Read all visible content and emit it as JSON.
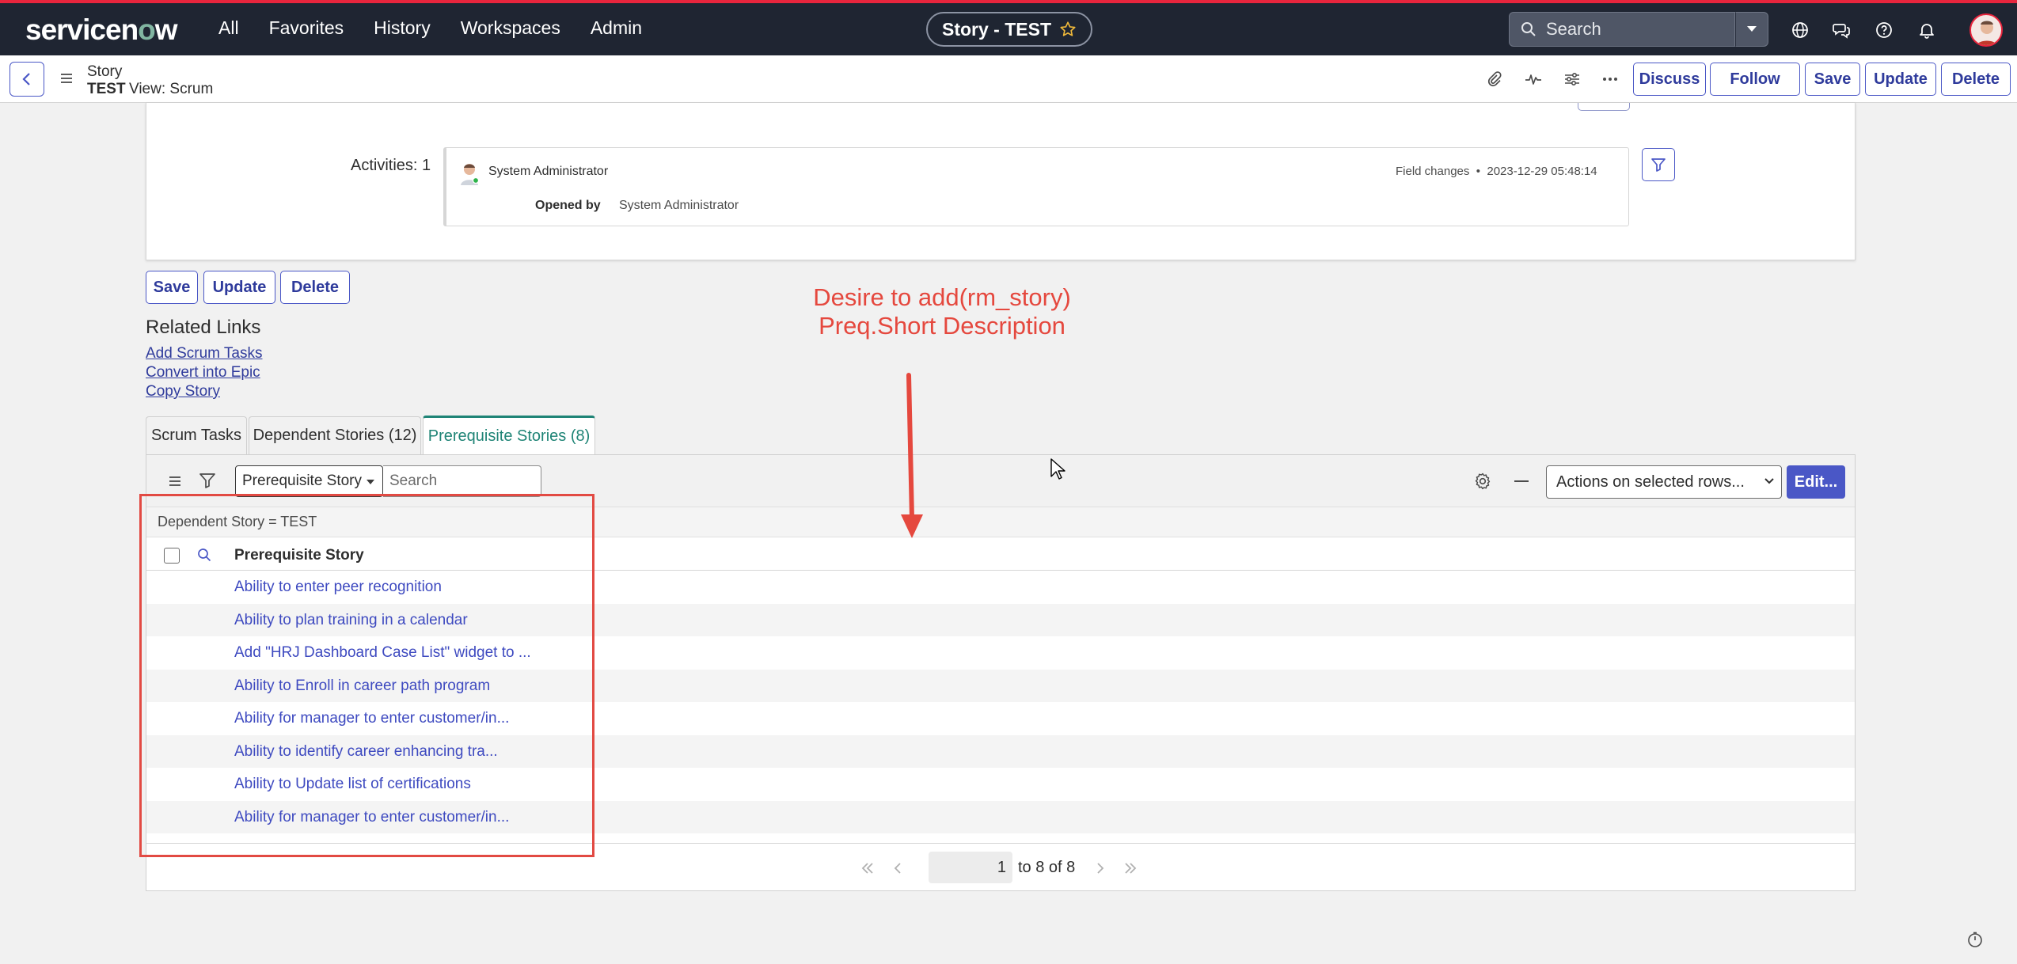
{
  "topbar": {
    "logo_prefix": "servicen",
    "logo_o": "o",
    "logo_suffix": "w",
    "nav": [
      "All",
      "Favorites",
      "History",
      "Workspaces",
      "Admin"
    ],
    "record_title": "Story - TEST",
    "search_placeholder": "Search",
    "icons": [
      "globe-icon",
      "chat-icon",
      "help-icon",
      "bell-icon"
    ],
    "bar_color": "#1f2532",
    "accent_color": "#e8253d"
  },
  "form_header": {
    "record_type": "Story",
    "record_name": "TEST",
    "view_label": "View: Scrum",
    "icons": [
      "paperclip-icon",
      "activity-icon",
      "settings-sliders-icon",
      "more-icon"
    ],
    "buttons": {
      "discuss": "Discuss",
      "follow": "Follow",
      "save": "Save",
      "update": "Update",
      "delete": "Delete"
    }
  },
  "activity": {
    "label": "Activities: 1",
    "user": "System Administrator",
    "meta_kind": "Field changes",
    "meta_bullet": "•",
    "timestamp": "2023-12-29 05:48:14",
    "field_label": "Opened by",
    "field_value": "System Administrator"
  },
  "bottom_buttons": {
    "save": "Save",
    "update": "Update",
    "delete": "Delete"
  },
  "related_links": {
    "title": "Related Links",
    "links": [
      "Add Scrum Tasks",
      "Convert into Epic",
      "Copy Story"
    ]
  },
  "tabs": [
    "Scrum Tasks",
    "Dependent Stories (12)",
    "Prerequisite Stories (8)"
  ],
  "active_tab": 2,
  "list": {
    "field_selector": "Prerequisite Story",
    "search_placeholder": "Search",
    "actions_label": "Actions on selected rows...",
    "edit_label": "Edit...",
    "breadcrumb": "Dependent Story = TEST",
    "column_header": "Prerequisite Story",
    "rows": [
      "Ability to enter peer recognition",
      "Ability to plan training in a calendar",
      "Add \"HRJ Dashboard Case List\" widget to ...",
      "Ability to Enroll in career path program",
      "Ability for manager to enter customer/in...",
      "Ability to identify career enhancing tra...",
      "Ability to Update list of certifications",
      "Ability for manager to enter customer/in..."
    ],
    "page_value": "1",
    "page_text": "to 8 of 8"
  },
  "annotation": {
    "line1": "Desire to add(rm_story)",
    "line2": "Preq.Short Description",
    "color": "#e5483e"
  }
}
